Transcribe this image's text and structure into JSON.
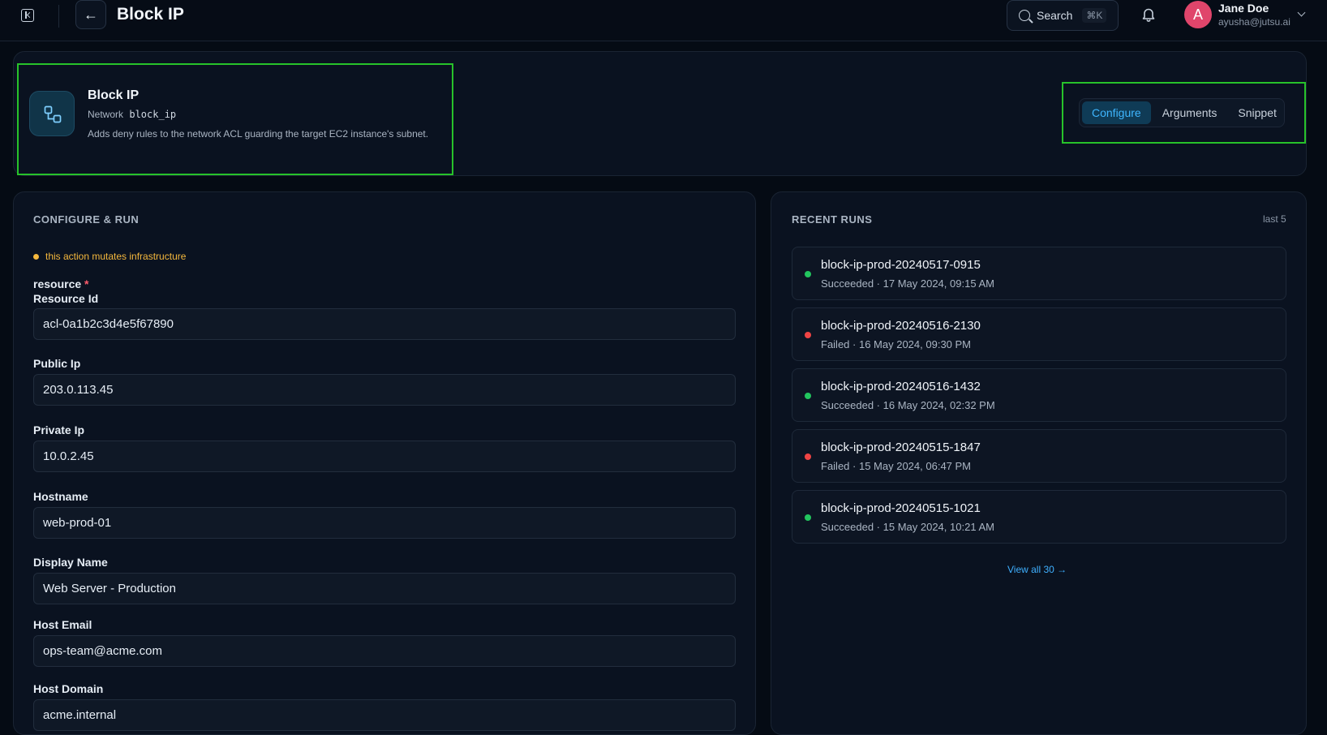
{
  "topbar": {
    "title": "Block IP",
    "search_label": "Search",
    "search_shortcut": "⌘K",
    "user_initial": "A",
    "user_name": "Jane Doe",
    "user_email": "ayusha@jutsu.ai"
  },
  "action": {
    "title": "Block IP",
    "category": "Network",
    "slug": "block_ip",
    "description": "Adds deny rules to the network ACL guarding the target EC2 instance's subnet."
  },
  "tabs": [
    {
      "label": "Configure",
      "active": true
    },
    {
      "label": "Arguments",
      "active": false
    },
    {
      "label": "Snippet",
      "active": false
    }
  ],
  "configure": {
    "heading": "CONFIGURE & RUN",
    "warning": "this action mutates infrastructure",
    "group_label": "resource",
    "required_mark": "*",
    "fields": [
      {
        "label": "Resource Id",
        "value": "acl-0a1b2c3d4e5f67890"
      },
      {
        "label": "Public Ip",
        "value": "203.0.113.45"
      },
      {
        "label": "Private Ip",
        "value": "10.0.2.45"
      },
      {
        "label": "Hostname",
        "value": "web-prod-01"
      },
      {
        "label": "Display Name",
        "value": "Web Server - Production"
      },
      {
        "label": "Host Email",
        "value": "ops-team@acme.com"
      },
      {
        "label": "Host Domain",
        "value": "acme.internal"
      }
    ]
  },
  "runs": {
    "heading": "RECENT RUNS",
    "count_label": "last 5",
    "items": [
      {
        "name": "block-ip-prod-20240517-0915",
        "status": "Succeeded",
        "time": "17 May 2024, 09:15 AM",
        "status_color": "#22c55e"
      },
      {
        "name": "block-ip-prod-20240516-2130",
        "status": "Failed",
        "time": "16 May 2024, 09:30 PM",
        "status_color": "#ef4444"
      },
      {
        "name": "block-ip-prod-20240516-1432",
        "status": "Succeeded",
        "time": "16 May 2024, 02:32 PM",
        "status_color": "#22c55e"
      },
      {
        "name": "block-ip-prod-20240515-1847",
        "status": "Failed",
        "time": "15 May 2024, 06:47 PM",
        "status_color": "#ef4444"
      },
      {
        "name": "block-ip-prod-20240515-1021",
        "status": "Succeeded",
        "time": "15 May 2024, 10:21 AM",
        "status_color": "#22c55e"
      }
    ],
    "view_all_label": "View all 30",
    "view_all_arrow": "→"
  },
  "colors": {
    "accent": "#3fb6ff",
    "highlight": "#27c22a",
    "warning": "#f5b83d",
    "success": "#22c55e",
    "failure": "#ef4444"
  }
}
